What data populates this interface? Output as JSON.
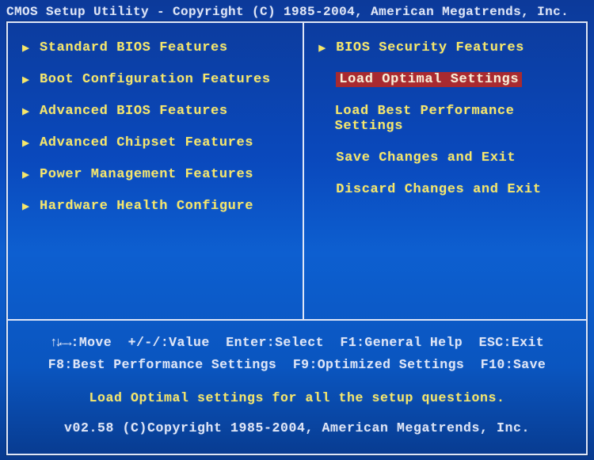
{
  "title": "CMOS Setup Utility - Copyright (C) 1985-2004, American Megatrends, Inc.",
  "left": {
    "items": [
      {
        "label": "Standard BIOS Features",
        "arrow": true
      },
      {
        "label": "Boot Configuration Features",
        "arrow": true
      },
      {
        "label": "Advanced BIOS Features",
        "arrow": true
      },
      {
        "label": "Advanced Chipset Features",
        "arrow": true
      },
      {
        "label": "Power Management Features",
        "arrow": true
      },
      {
        "label": "Hardware Health Configure",
        "arrow": true
      }
    ]
  },
  "right": {
    "items": [
      {
        "label": "BIOS Security Features",
        "arrow": true,
        "selected": false
      },
      {
        "label": "Load Optimal Settings",
        "arrow": false,
        "selected": true
      },
      {
        "label": "Load Best Performance Settings",
        "arrow": false,
        "selected": false
      },
      {
        "label": "Save Changes and Exit",
        "arrow": false,
        "selected": false
      },
      {
        "label": "Discard Changes and Exit",
        "arrow": false,
        "selected": false
      }
    ]
  },
  "help": {
    "line1": {
      "arrows": "↑↓←→",
      "move": ":Move",
      "value": "+/-/:Value",
      "select": "Enter:Select",
      "general": "F1:General Help",
      "exit": "ESC:Exit"
    },
    "line2": {
      "f8": "F8:Best Performance Settings",
      "f9": "F9:Optimized Settings",
      "f10": "F10:Save"
    }
  },
  "status": "Load Optimal settings for all the setup questions.",
  "copyright": "v02.58 (C)Copyright 1985-2004, American Megatrends, Inc."
}
